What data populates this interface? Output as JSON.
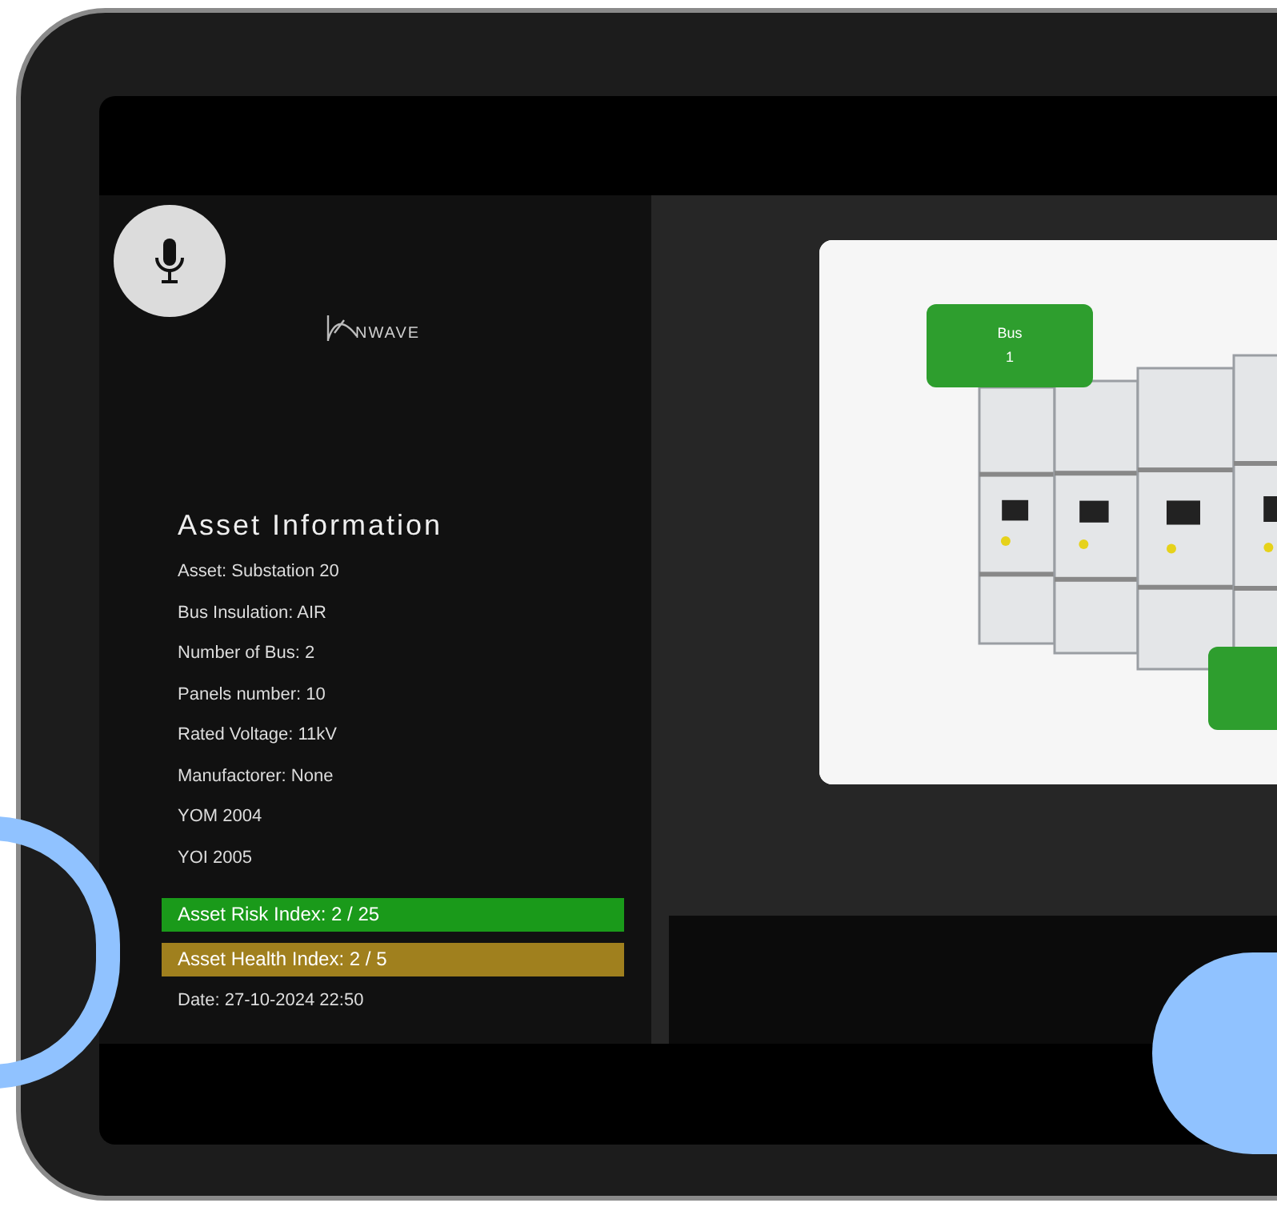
{
  "logo": {
    "text": "NWAVE"
  },
  "panel": {
    "title": "Asset Information",
    "details": [
      "Asset: Substation 20",
      "Bus Insulation: AIR",
      "Number of Bus: 2",
      "Panels number: 10",
      "Rated Voltage: 11kV",
      "Manufactorer: None",
      "YOM 2004",
      "YOI 2005"
    ],
    "indices": [
      {
        "text": "Asset Risk Index: 2 / 25",
        "color": "#1a9a1a"
      },
      {
        "text": "Asset Health Index: 2 / 5",
        "color": "#a0801e"
      }
    ],
    "date": "Date: 27-10-2024 22:50"
  },
  "viewer": {
    "labels": [
      {
        "title": "Bus",
        "number": "1"
      }
    ]
  }
}
